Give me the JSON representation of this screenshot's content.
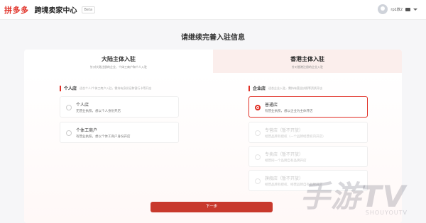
{
  "header": {
    "logo": "拼多多",
    "title": "跨境卖家中心",
    "beta": "Beta",
    "user_name": "rp1数2"
  },
  "page_title": "请继续完善入驻信息",
  "tabs": [
    {
      "label": "大陆主体入驻",
      "sub": "针对大陆注册的企业、个体工商户和个人入驻"
    },
    {
      "label": "香港主体入驻",
      "sub": "针对香港注册的企业入驻"
    }
  ],
  "personal": {
    "label": "个人店",
    "hint": "适合个人/个体工商户入驻，需持有身份证和银行卡等开店",
    "options": [
      {
        "name": "个人店",
        "desc": "无营业执照，想以个人身份开店"
      },
      {
        "name": "个体工商户",
        "desc": "有营业执照，想以个体工商户身份开店"
      }
    ]
  },
  "enterprise": {
    "label": "企业店",
    "hint": "适合企业入驻，需持有营业执照等资质开店",
    "options": [
      {
        "name": "普通店",
        "desc": "有营业执照，想以企业为主体开店"
      },
      {
        "name": "专营店（暂不开放）",
        "desc": "经营品牌有授权（一个品牌经营权内开店）"
      },
      {
        "name": "专卖店（暂不开放）",
        "desc": "经营同一个品牌自有品牌开店"
      },
      {
        "name": "旗舰店（暂不开放）",
        "desc": "经营品牌有授权，经营品牌自有品牌开店"
      }
    ]
  },
  "next_button": "下一步",
  "watermark": "手游TV",
  "watermark_sub": "SHOUYOUTV"
}
